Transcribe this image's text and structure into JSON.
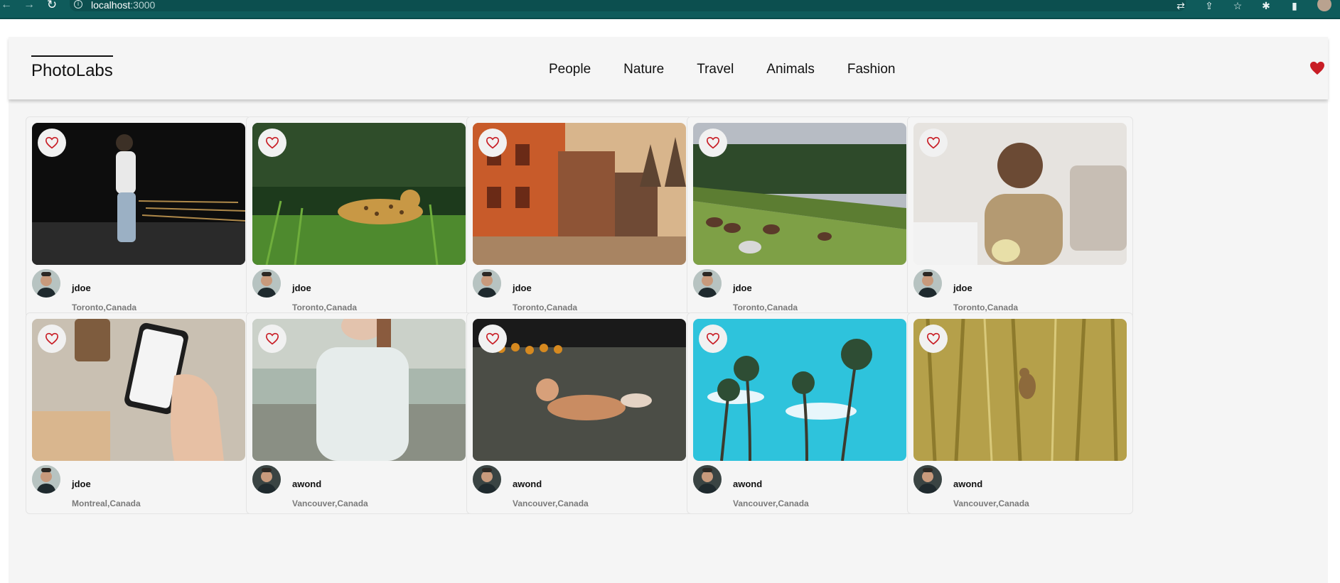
{
  "browser": {
    "url_host": "localhost",
    "url_port": ":3000",
    "icons": [
      "back-icon",
      "forward-icon",
      "reload-icon",
      "info-icon",
      "translate-icon",
      "share-icon",
      "star-icon",
      "extensions-icon",
      "sidepanel-icon",
      "profile-avatar"
    ]
  },
  "app": {
    "logo": "PhotoLabs",
    "topics": [
      "People",
      "Nature",
      "Travel",
      "Animals",
      "Fashion"
    ],
    "fav_badge_color": "#c81d25"
  },
  "photos": [
    {
      "username": "jdoe",
      "location": "Toronto,Canada",
      "scene": "person-night-street"
    },
    {
      "username": "jdoe",
      "location": "Toronto,Canada",
      "scene": "leopard-grass"
    },
    {
      "username": "jdoe",
      "location": "Toronto,Canada",
      "scene": "orange-buildings-temple"
    },
    {
      "username": "jdoe",
      "location": "Toronto,Canada",
      "scene": "horses-hillside"
    },
    {
      "username": "jdoe",
      "location": "Toronto,Canada",
      "scene": "man-coffee-mug"
    },
    {
      "username": "jdoe",
      "location": "Montreal,Canada",
      "scene": "phone-in-hand"
    },
    {
      "username": "awond",
      "location": "Vancouver,Canada",
      "scene": "woman-white-top"
    },
    {
      "username": "awond",
      "location": "Vancouver,Canada",
      "scene": "dog-lying-ground"
    },
    {
      "username": "awond",
      "location": "Vancouver,Canada",
      "scene": "palm-trees-blue-sky"
    },
    {
      "username": "awond",
      "location": "Vancouver,Canada",
      "scene": "bird-on-reeds"
    }
  ]
}
